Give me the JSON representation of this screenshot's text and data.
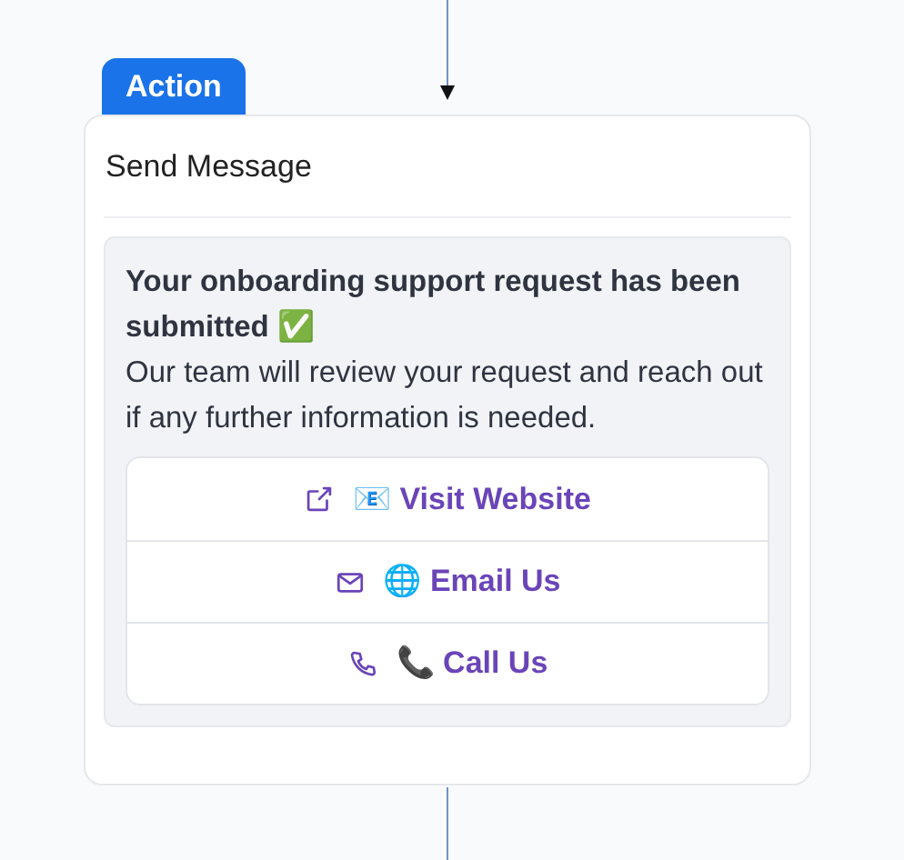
{
  "node": {
    "tag": "Action",
    "title": "Send Message"
  },
  "message": {
    "heading": "Your onboarding support request has been submitted ✅",
    "body": "Our team will review your request and reach out if any further information is needed."
  },
  "buttons": [
    {
      "kind": "link",
      "label": "📧 Visit Website"
    },
    {
      "kind": "email",
      "label": "🌐 Email Us"
    },
    {
      "kind": "phone",
      "label": "📞 Call Us"
    }
  ]
}
